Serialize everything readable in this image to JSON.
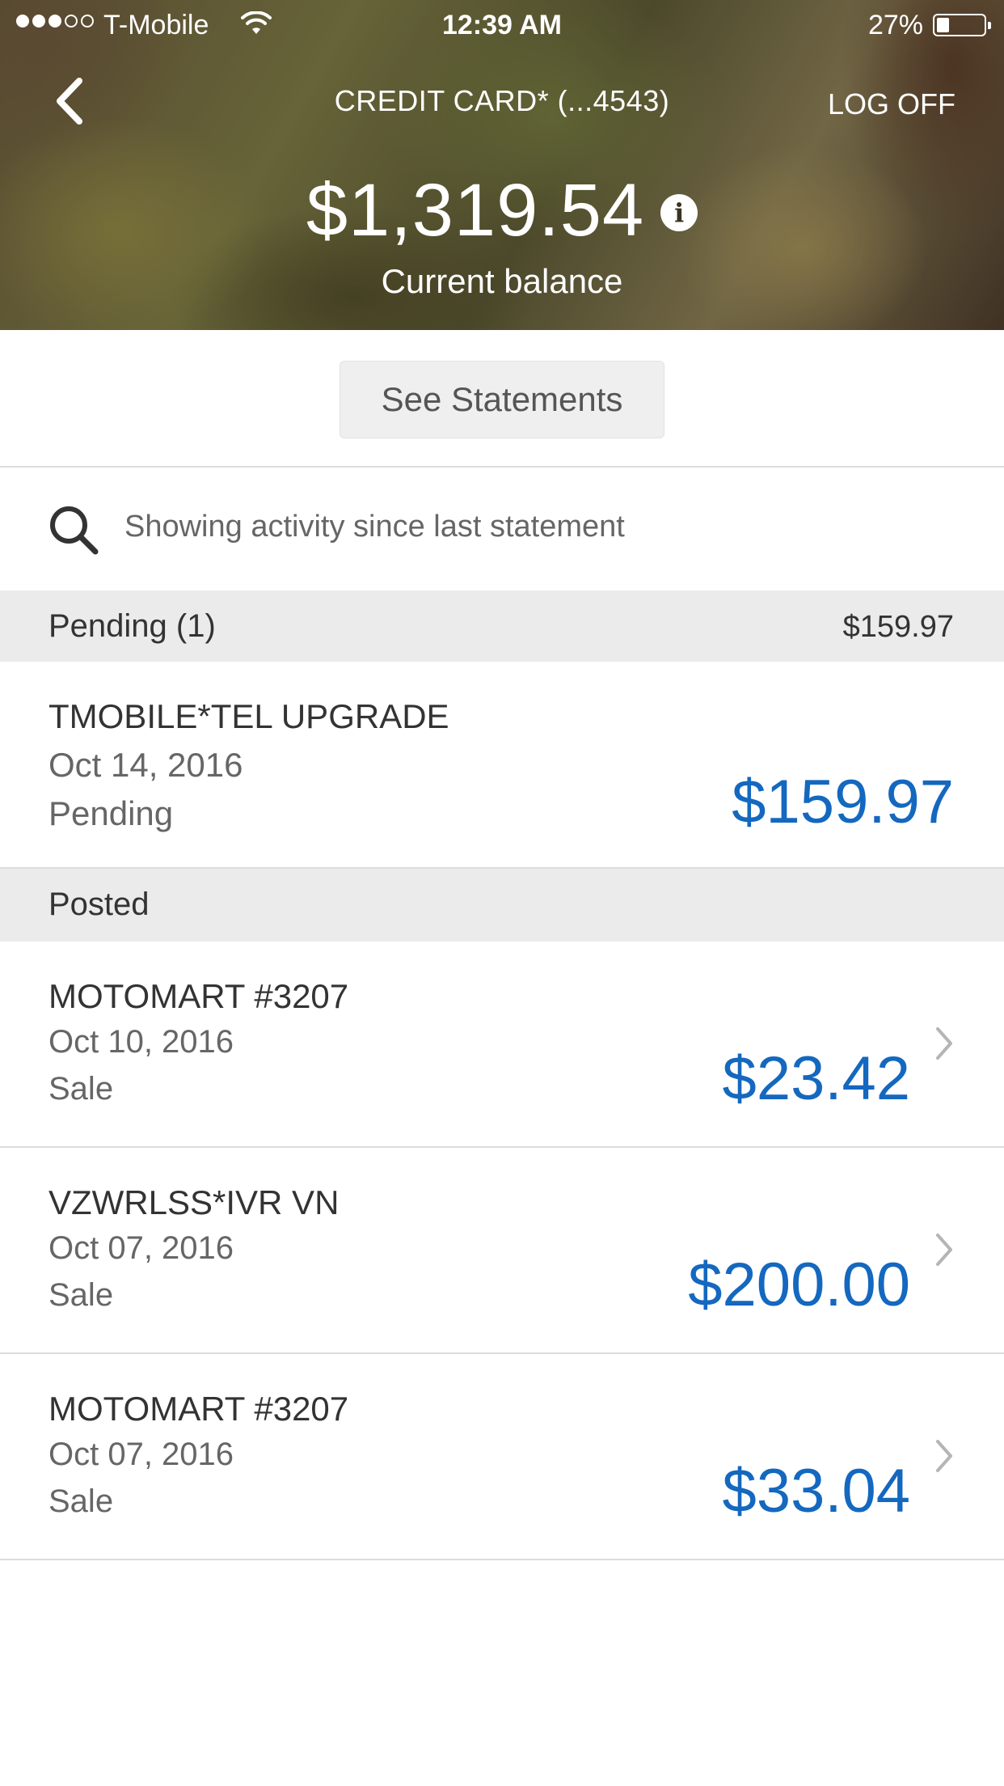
{
  "status_bar": {
    "carrier": "T-Mobile",
    "time": "12:39 AM",
    "battery_percent": "27%",
    "battery_level": 0.27,
    "signal_bars_filled": 3,
    "signal_bars_total": 5
  },
  "nav": {
    "title": "CREDIT CARD* (...4543)",
    "logoff_label": "LOG OFF",
    "back_icon": "chevron-left-icon"
  },
  "balance": {
    "amount": "$1,319.54",
    "label": "Current balance",
    "info_icon": "i"
  },
  "statements_button": {
    "label": "See Statements"
  },
  "search": {
    "text": "Showing activity since last statement",
    "icon": "search-icon"
  },
  "pending_section": {
    "label": "Pending (1)",
    "total": "$159.97",
    "transactions": [
      {
        "merchant": "TMOBILE*TEL UPGRADE",
        "date": "Oct 14, 2016",
        "status": "Pending",
        "amount": "$159.97"
      }
    ]
  },
  "posted_section": {
    "label": "Posted",
    "transactions": [
      {
        "merchant": "MOTOMART #3207",
        "date": "Oct 10, 2016",
        "status": "Sale",
        "amount": "$23.42"
      },
      {
        "merchant": "VZWRLSS*IVR VN",
        "date": "Oct 07, 2016",
        "status": "Sale",
        "amount": "$200.00"
      },
      {
        "merchant": "MOTOMART #3207",
        "date": "Oct 07, 2016",
        "status": "Sale",
        "amount": "$33.04"
      }
    ]
  },
  "colors": {
    "accent_blue": "#1468bf",
    "section_bg": "#ebebeb",
    "divider": "#dcdcdc"
  }
}
